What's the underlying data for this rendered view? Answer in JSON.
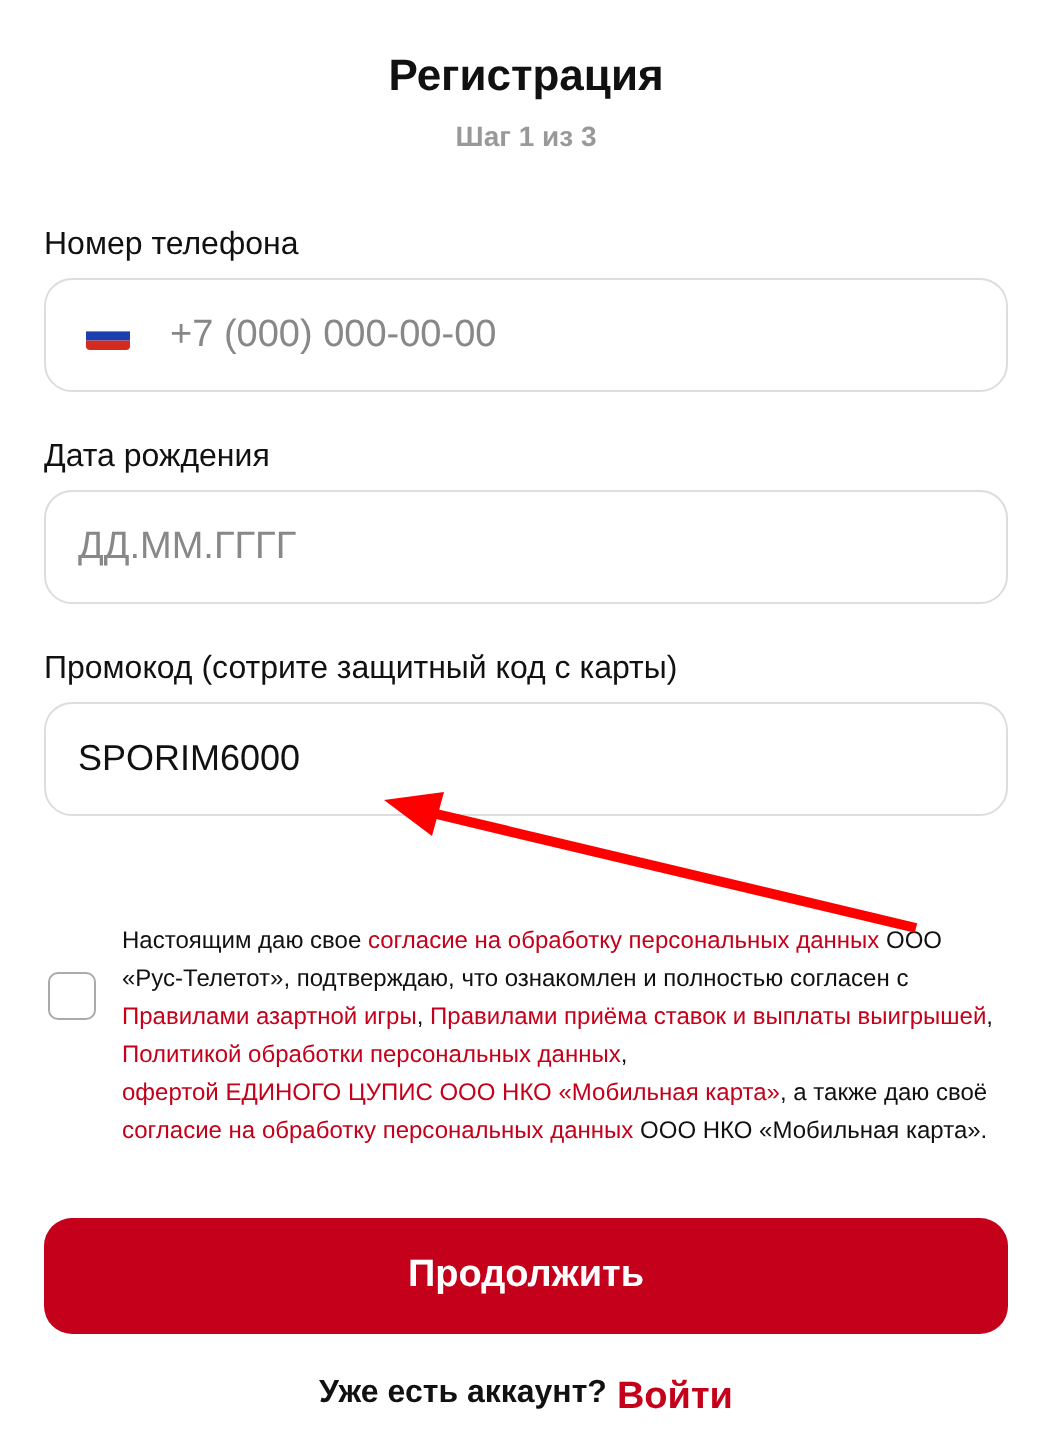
{
  "title": "Регистрация",
  "step": "Шаг 1 из 3",
  "fields": [
    {
      "kind": "phone",
      "label": "Номер телефона",
      "placeholder": "+7 (000) 000-00-00"
    },
    {
      "kind": "text",
      "label": "Дата рождения",
      "placeholder": "ДД.ММ.ГГГГ"
    },
    {
      "kind": "text",
      "label": "Промокод (сотрите защитный код с карты)",
      "value": "SPORIM6000"
    }
  ],
  "consent": {
    "checked": false,
    "parts": [
      {
        "kind": "text",
        "text": "Настоящим даю свое "
      },
      {
        "kind": "link",
        "text": "согласие на обработку персональных данных"
      },
      {
        "kind": "text",
        "text": " ООО «Рус-Телетот», подтверждаю, что ознакомлен и полностью согласен с "
      },
      {
        "kind": "link",
        "text": "Правилами азартной игры"
      },
      {
        "kind": "text",
        "text": ", "
      },
      {
        "kind": "link",
        "text": "Правилами приёма ставок и выплаты выигрышей"
      },
      {
        "kind": "text",
        "text": ", "
      },
      {
        "kind": "link",
        "text": "Политикой обработки персональных данных"
      },
      {
        "kind": "text",
        "text": ", "
      },
      {
        "kind": "link",
        "text": "офертой ЕДИНОГО ЦУПИС ООО НКО «Мобильная карта»"
      },
      {
        "kind": "text",
        "text": ", а также даю своё "
      },
      {
        "kind": "link",
        "text": "согласие на обработку персональных данных"
      },
      {
        "kind": "text",
        "text": " ООО НКО «Мобильная карта»."
      }
    ]
  },
  "submit": "Продолжить",
  "login": {
    "text": "Уже есть аккаунт?",
    "link": "Войти"
  }
}
